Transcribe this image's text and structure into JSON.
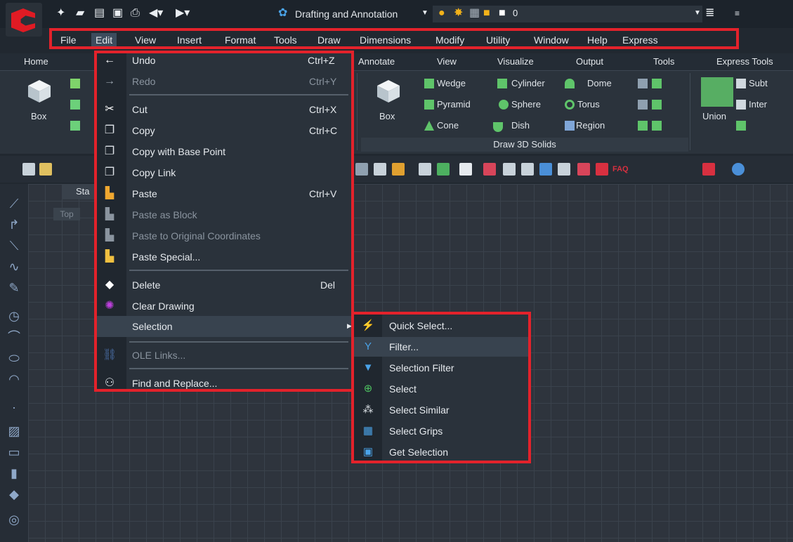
{
  "app": {
    "workspace": "Drafting and Annotation",
    "layer_value": "0"
  },
  "menubar": {
    "items": [
      "File",
      "Edit",
      "View",
      "Insert",
      "Format",
      "Tools",
      "Draw",
      "Dimensions",
      "Modify",
      "Utility",
      "Window",
      "Help",
      "Express"
    ],
    "active": "Edit"
  },
  "ribbon": {
    "tabs": [
      "Home",
      "Annotate",
      "View",
      "Visualize",
      "Output",
      "Tools",
      "Express Tools"
    ],
    "box_label": "Box",
    "box2_label": "Box",
    "union_label": "Union",
    "items": [
      "Wedge",
      "Cylinder",
      "Dome",
      "Pyramid",
      "Sphere",
      "Torus",
      "Cone",
      "Dish",
      "Region"
    ],
    "panel_label": "Draw 3D Solids",
    "right_items": [
      "Subt",
      "Inter"
    ]
  },
  "drawing": {
    "file_tab": "Sta",
    "view_label": "Top"
  },
  "toolbar": {
    "faq_label": "FAQ"
  },
  "edit_menu": {
    "items": [
      {
        "label": "Undo",
        "shortcut": "Ctrl+Z",
        "enabled": true,
        "icon": "undo-arrow-icon"
      },
      {
        "label": "Redo",
        "shortcut": "Ctrl+Y",
        "enabled": false,
        "icon": "redo-arrow-icon"
      },
      {
        "label": "Cut",
        "shortcut": "Ctrl+X",
        "enabled": true,
        "icon": "scissors-icon"
      },
      {
        "label": "Copy",
        "shortcut": "Ctrl+C",
        "enabled": true,
        "icon": "copy-icon"
      },
      {
        "label": "Copy with Base Point",
        "shortcut": "",
        "enabled": true,
        "icon": "copy-base-point-icon"
      },
      {
        "label": "Copy Link",
        "shortcut": "",
        "enabled": true,
        "icon": "copy-link-icon"
      },
      {
        "label": "Paste",
        "shortcut": "Ctrl+V",
        "enabled": true,
        "icon": "paste-icon"
      },
      {
        "label": "Paste as Block",
        "shortcut": "",
        "enabled": false,
        "icon": "paste-block-icon"
      },
      {
        "label": "Paste to Original Coordinates",
        "shortcut": "",
        "enabled": false,
        "icon": "paste-original-icon"
      },
      {
        "label": "Paste Special...",
        "shortcut": "",
        "enabled": true,
        "icon": "paste-special-icon"
      },
      {
        "label": "Delete",
        "shortcut": "Del",
        "enabled": true,
        "icon": "eraser-icon"
      },
      {
        "label": "Clear Drawing",
        "shortcut": "",
        "enabled": true,
        "icon": "clear-drawing-icon"
      },
      {
        "label": "Selection",
        "shortcut": "",
        "enabled": true,
        "icon": ""
      },
      {
        "label": "OLE Links...",
        "shortcut": "",
        "enabled": false,
        "icon": "chain-link-icon"
      },
      {
        "label": "Find and Replace...",
        "shortcut": "",
        "enabled": true,
        "icon": "binoculars-icon"
      }
    ]
  },
  "selection_submenu": {
    "items": [
      {
        "label": "Quick Select...",
        "icon": "quick-select-icon"
      },
      {
        "label": "Filter...",
        "icon": "filter-icon"
      },
      {
        "label": "Selection Filter",
        "icon": "selection-filter-icon"
      },
      {
        "label": "Select",
        "icon": "select-icon"
      },
      {
        "label": "Select Similar",
        "icon": "select-similar-icon"
      },
      {
        "label": "Select Grips",
        "icon": "select-grips-icon"
      },
      {
        "label": "Get Selection",
        "icon": "get-selection-icon"
      }
    ],
    "highlighted": "Filter..."
  },
  "colors": {
    "highlight_outline": "#e3222b",
    "menu_bg": "#2a323b",
    "canvas_bg": "#2e343d",
    "brand": "#e01b24"
  }
}
